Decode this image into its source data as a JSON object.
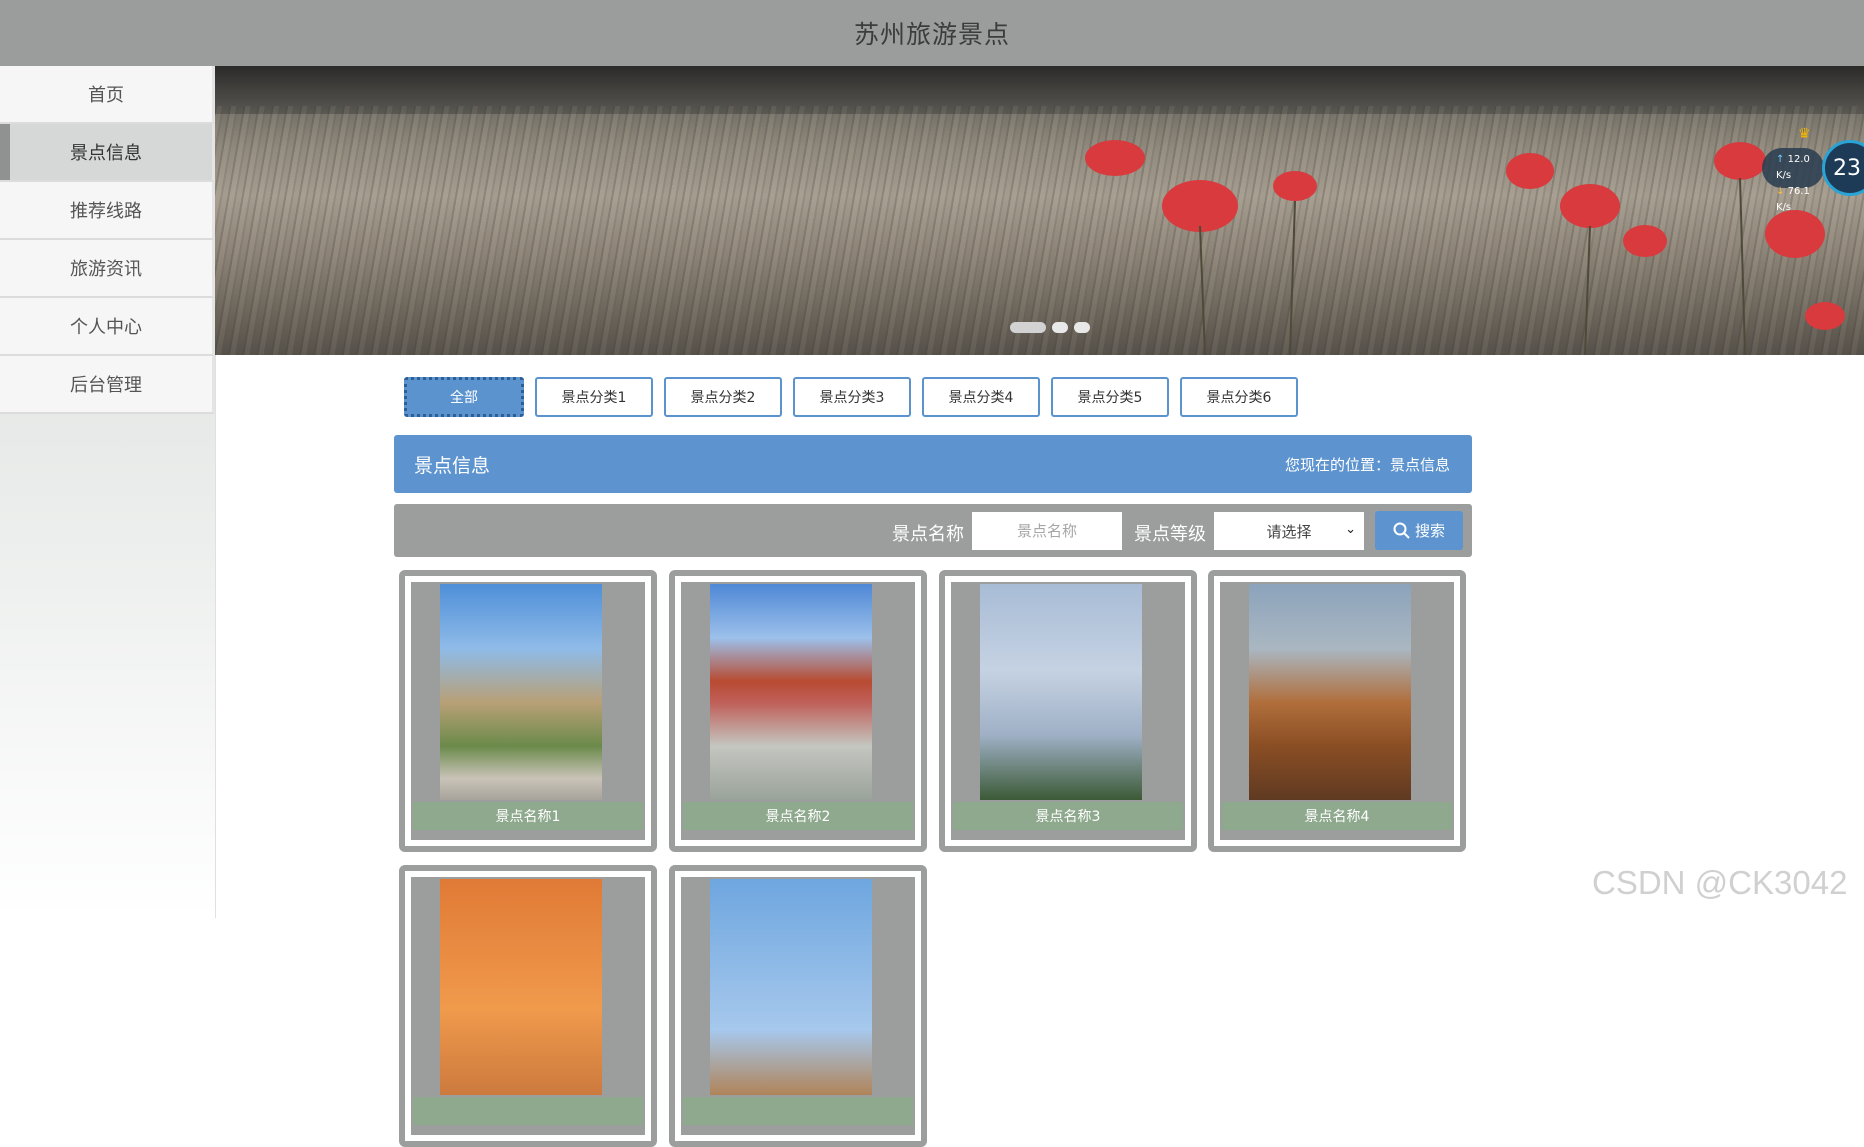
{
  "header": {
    "title": "苏州旅游景点"
  },
  "sidebar": {
    "items": [
      {
        "label": "首页"
      },
      {
        "label": "景点信息"
      },
      {
        "label": "推荐线路"
      },
      {
        "label": "旅游资讯"
      },
      {
        "label": "个人中心"
      },
      {
        "label": "后台管理"
      }
    ]
  },
  "network": {
    "upload": "12.0 K/s",
    "download": "76.1 K/s",
    "temp": "23"
  },
  "tabs": [
    {
      "label": "全部"
    },
    {
      "label": "景点分类1"
    },
    {
      "label": "景点分类2"
    },
    {
      "label": "景点分类3"
    },
    {
      "label": "景点分类4"
    },
    {
      "label": "景点分类5"
    },
    {
      "label": "景点分类6"
    }
  ],
  "section": {
    "title": "景点信息",
    "location": "您现在的位置：景点信息"
  },
  "search": {
    "name_label": "景点名称",
    "name_placeholder": "景点名称",
    "level_label": "景点等级",
    "level_value": "请选择",
    "button_label": "搜索"
  },
  "cards": [
    {
      "name": "景点名称1"
    },
    {
      "name": "景点名称2"
    },
    {
      "name": "景点名称3"
    },
    {
      "name": "景点名称4"
    },
    {
      "name": ""
    },
    {
      "name": ""
    }
  ],
  "watermark": "CSDN @CK3042"
}
